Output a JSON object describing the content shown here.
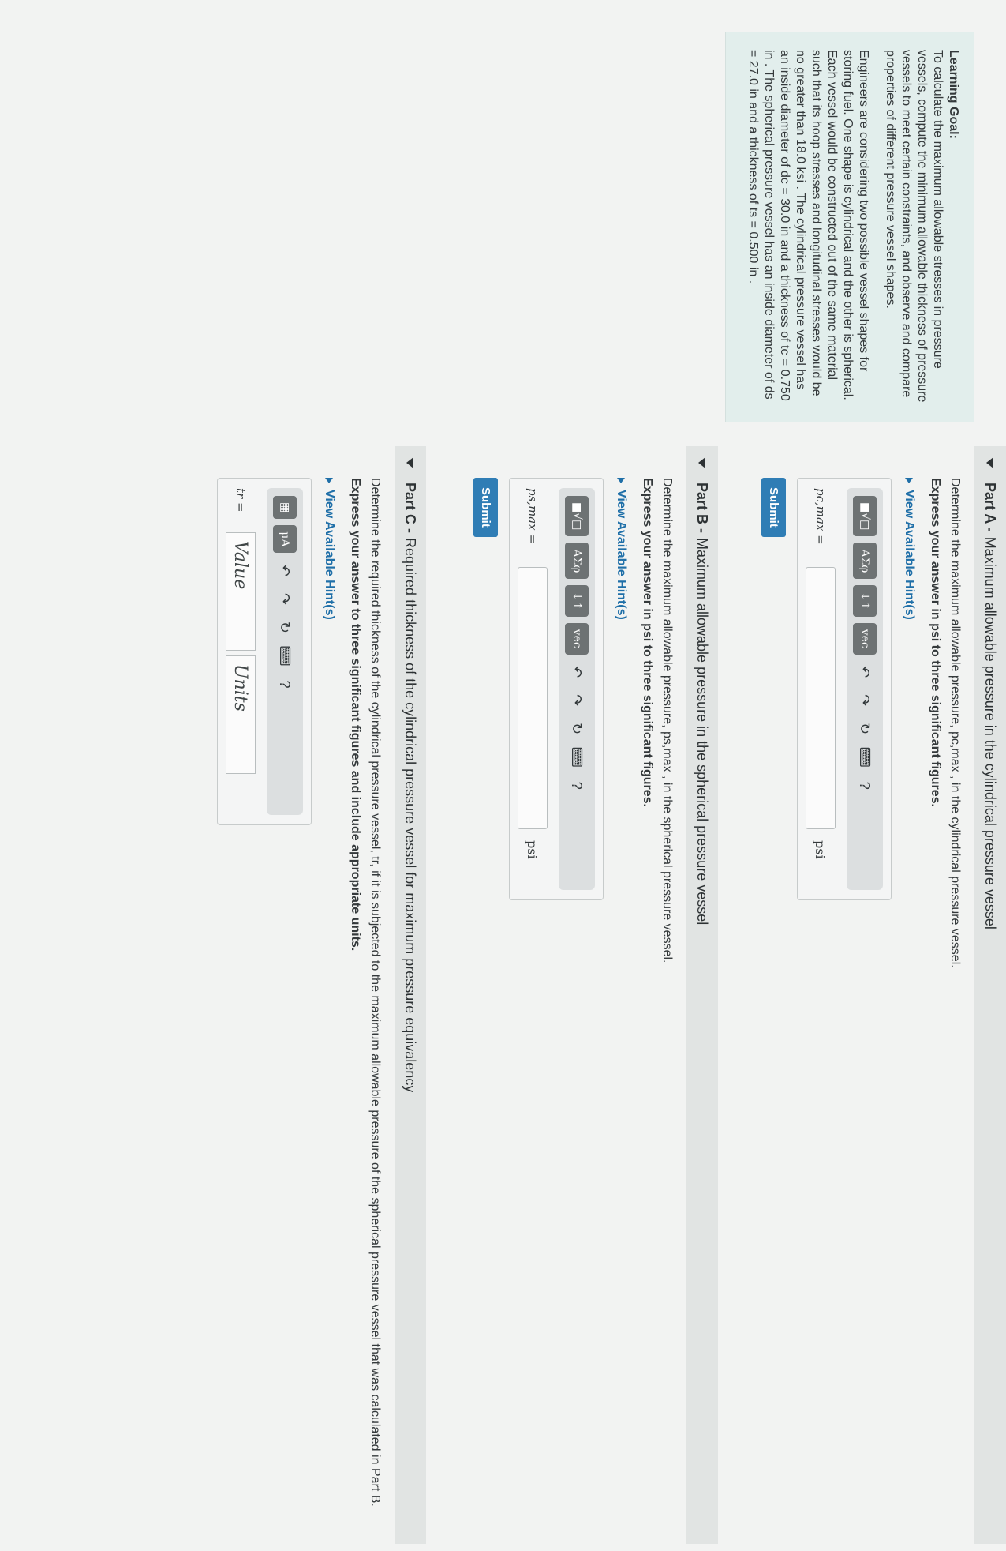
{
  "learning_goal": {
    "heading": "Learning Goal:",
    "p1": "To calculate the maximum allowable stresses in pressure vessels, compute the minimum allowable thickness of pressure vessels to meet certain constraints, and observe and compare properties of different pressure vessel shapes.",
    "p2": "Engineers are considering two possible vessel shapes for storing fuel. One shape is cylindrical and the other is spherical. Each vessel would be constructed out of the same material such that its hoop stresses and longitudinal stresses would be no greater than 18.0 ksi . The cylindrical pressure vessel has an inside diameter of dc = 30.0 in and a thickness of tc = 0.750 in . The spherical pressure vessel has an inside diameter of ds = 27.0 in and a thickness of ts = 0.500 in ."
  },
  "part_a": {
    "label": "Part A -",
    "title": "Maximum allowable pressure in the cylindrical pressure vessel",
    "prompt": "Determine the maximum allowable pressure, pc,max , in the cylindrical pressure vessel.",
    "instruction": "Express your answer in psi to three significant figures.",
    "hint": "View Available Hint(s)",
    "var": "pc,max =",
    "unit": "psi",
    "submit": "Submit"
  },
  "part_b": {
    "label": "Part B -",
    "title": "Maximum allowable pressure in the spherical pressure vessel",
    "prompt": "Determine the maximum allowable pressure, ps,max , in the spherical pressure vessel.",
    "instruction": "Express your answer in psi to three significant figures.",
    "hint": "View Available Hint(s)",
    "var": "ps,max =",
    "unit": "psi",
    "submit": "Submit"
  },
  "part_c": {
    "label": "Part C -",
    "title": "Required thickness of the cylindrical pressure vessel for maximum pressure equivalency",
    "prompt": "Determine the required thickness of the cylindrical pressure vessel, tr, if it is subjected to the maximum allowable pressure of the spherical pressure vessel that was calculated in Part B.",
    "instruction": "Express your answer to three significant figures and include appropriate units.",
    "hint": "View Available Hint(s)",
    "var": "tr =",
    "value_placeholder": "Value",
    "units_placeholder": "Units"
  },
  "toolbar": {
    "templates": "■√□",
    "greek": "ΑΣφ",
    "arrows": "↓↑",
    "vec": "vec",
    "units_btn": "μA",
    "help": "?"
  }
}
